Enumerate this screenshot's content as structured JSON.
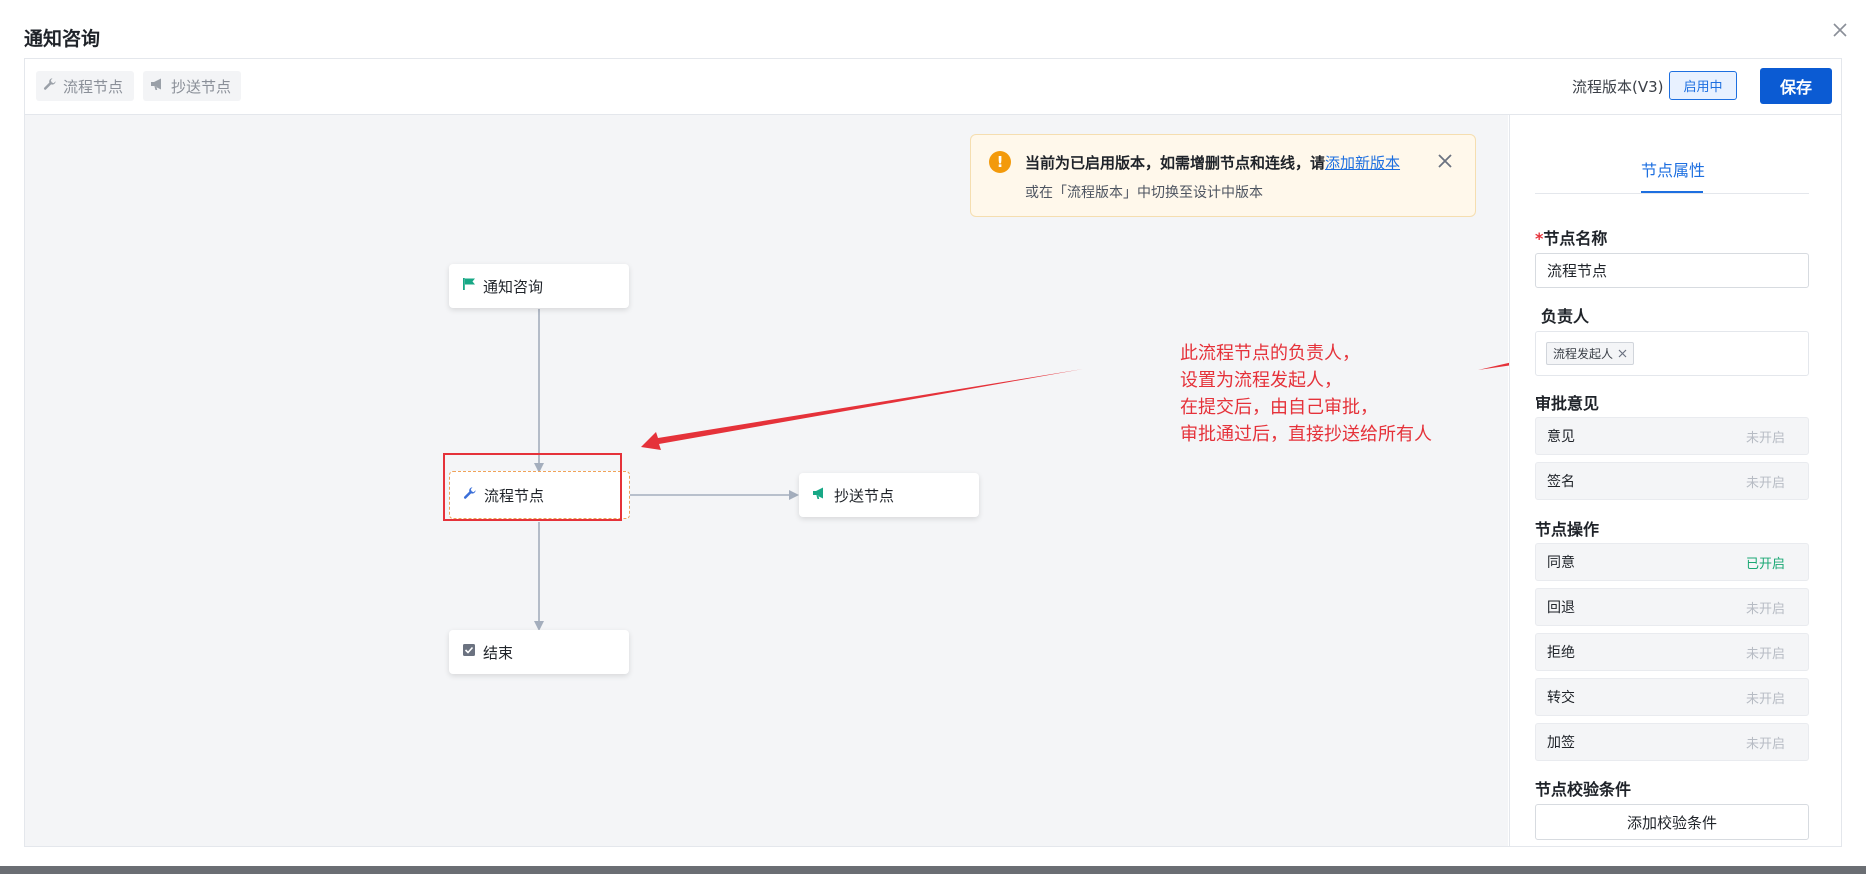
{
  "dialog": {
    "title": "通知咨询"
  },
  "toolbar": {
    "process_node_label": "流程节点",
    "cc_node_label": "抄送节点",
    "version_label": "流程版本(V3)",
    "version_status": "启用中",
    "save_label": "保存"
  },
  "alert": {
    "message": "当前为已启用版本，如需增删节点和连线，请",
    "link_text": "添加新版本",
    "sub_message": "或在「流程版本」中切换至设计中版本"
  },
  "flow": {
    "start_node": "通知咨询",
    "process_node": "流程节点",
    "cc_node": "抄送节点",
    "end_node": "结束"
  },
  "annotation": {
    "lines": [
      "此流程节点的负责人，",
      "设置为流程发起人，",
      "在提交后，由自己审批，",
      "审批通过后，直接抄送给所有人"
    ]
  },
  "panel": {
    "tab_label": "节点属性",
    "node_name_label": "节点名称",
    "node_name_required_mark": "*",
    "node_name_value": "流程节点",
    "owner_label": "负责人",
    "owner_tag": "流程发起人",
    "approval_opinion_title": "审批意见",
    "approval_opinions": [
      {
        "label": "意见",
        "status": "未开启"
      },
      {
        "label": "签名",
        "status": "未开启"
      }
    ],
    "node_ops_title": "节点操作",
    "node_ops": [
      {
        "label": "同意",
        "status": "已开启"
      },
      {
        "label": "回退",
        "status": "未开启"
      },
      {
        "label": "拒绝",
        "status": "未开启"
      },
      {
        "label": "转交",
        "status": "未开启"
      },
      {
        "label": "加签",
        "status": "未开启"
      }
    ],
    "validation_title": "节点校验条件",
    "add_validation_label": "添加校验条件"
  },
  "colors": {
    "primary": "#0b5bd3",
    "accent_blue": "#1d6fe0",
    "warning": "#f39a0b",
    "annotation_red": "#e5323a",
    "enabled_green": "#1aa874",
    "canvas_bg": "#f4f5f7"
  },
  "icons": {
    "close": "close-icon",
    "wrench": "wrench-icon",
    "megaphone": "megaphone-icon",
    "flag": "flag-icon",
    "checkbox": "checkbox-icon",
    "warning": "warning-icon"
  }
}
